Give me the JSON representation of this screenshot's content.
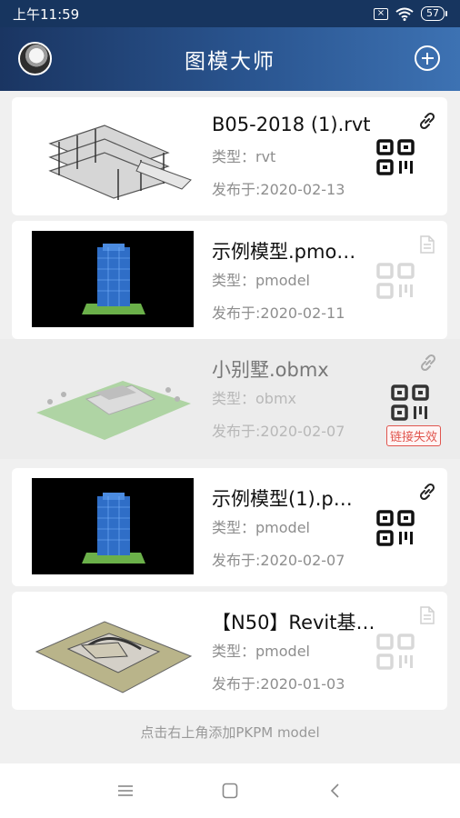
{
  "status": {
    "time": "上午11:59",
    "battery": "57"
  },
  "header": {
    "title": "图模大师"
  },
  "models": [
    {
      "name": "B05-2018 (1).rvt",
      "type": "类型：rvt",
      "date": "发布于:2020-02-13",
      "link_state": "link"
    },
    {
      "name": "示例模型.pmo…",
      "type": "类型：pmodel",
      "date": "发布于:2020-02-11",
      "link_state": "file"
    },
    {
      "name": "小别墅.obmx",
      "type": "类型：obmx",
      "date": "发布于:2020-02-07",
      "link_state": "invalid",
      "invalid_label": "链接失效"
    },
    {
      "name": "示例模型(1).p…",
      "type": "类型：pmodel",
      "date": "发布于:2020-02-07",
      "link_state": "link"
    },
    {
      "name": "【N50】Revit基…",
      "type": "类型：pmodel",
      "date": "发布于:2020-01-03",
      "link_state": "file"
    }
  ],
  "footer": {
    "hint": "点击右上角添加PKPM model"
  },
  "colors": {
    "header_start": "#1a3562",
    "header_end": "#3d72b3",
    "invalid": "#e0554e"
  }
}
